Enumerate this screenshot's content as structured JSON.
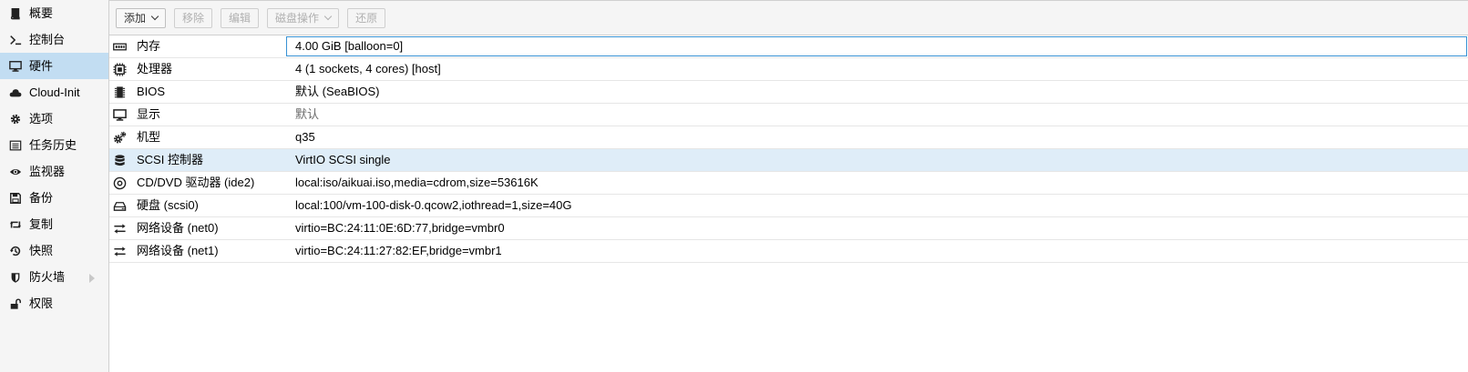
{
  "sidebar": {
    "items": [
      {
        "label": "概要",
        "icon": "book-icon",
        "selected": false
      },
      {
        "label": "控制台",
        "icon": "terminal-icon",
        "selected": false
      },
      {
        "label": "硬件",
        "icon": "desktop-icon",
        "selected": true
      },
      {
        "label": "Cloud-Init",
        "icon": "cloud-icon",
        "selected": false
      },
      {
        "label": "选项",
        "icon": "gear-icon",
        "selected": false
      },
      {
        "label": "任务历史",
        "icon": "list-icon",
        "selected": false
      },
      {
        "label": "监视器",
        "icon": "eye-icon",
        "selected": false
      },
      {
        "label": "备份",
        "icon": "floppy-icon",
        "selected": false
      },
      {
        "label": "复制",
        "icon": "retweet-icon",
        "selected": false
      },
      {
        "label": "快照",
        "icon": "history-icon",
        "selected": false
      },
      {
        "label": "防火墙",
        "icon": "shield-icon",
        "selected": false,
        "has_submenu": true
      },
      {
        "label": "权限",
        "icon": "unlock-icon",
        "selected": false
      }
    ]
  },
  "toolbar": {
    "add_label": "添加",
    "remove_label": "移除",
    "edit_label": "编辑",
    "disk_action_label": "磁盘操作",
    "revert_label": "还原"
  },
  "hardware": {
    "rows": [
      {
        "name": "内存",
        "value": "4.00 GiB [balloon=0]",
        "icon": "memory-icon"
      },
      {
        "name": "处理器",
        "value": "4 (1 sockets, 4 cores) [host]",
        "icon": "cpu-icon"
      },
      {
        "name": "BIOS",
        "value": "默认 (SeaBIOS)",
        "icon": "microchip-icon"
      },
      {
        "name": "显示",
        "value": "默认",
        "icon": "desktop-icon"
      },
      {
        "name": "机型",
        "value": "q35",
        "icon": "cogs-icon"
      },
      {
        "name": "SCSI 控制器",
        "value": "VirtIO SCSI single",
        "icon": "database-icon"
      },
      {
        "name": "CD/DVD 驱动器 (ide2)",
        "value": "local:iso/aikuai.iso,media=cdrom,size=53616K",
        "icon": "cdrom-icon"
      },
      {
        "name": "硬盘 (scsi0)",
        "value": "local:100/vm-100-disk-0.qcow2,iothread=1,size=40G",
        "icon": "harddisk-icon"
      },
      {
        "name": "网络设备 (net0)",
        "value": "virtio=BC:24:11:0E:6D:77,bridge=vmbr0",
        "icon": "exchange-icon"
      },
      {
        "name": "网络设备 (net1)",
        "value": "virtio=BC:24:11:27:82:EF,bridge=vmbr1",
        "icon": "exchange-icon"
      }
    ]
  },
  "colors": {
    "selected_nav_bg": "#c2ddf2",
    "selected_row_bg": "#dfedf8",
    "edit_border": "#3892d4"
  }
}
